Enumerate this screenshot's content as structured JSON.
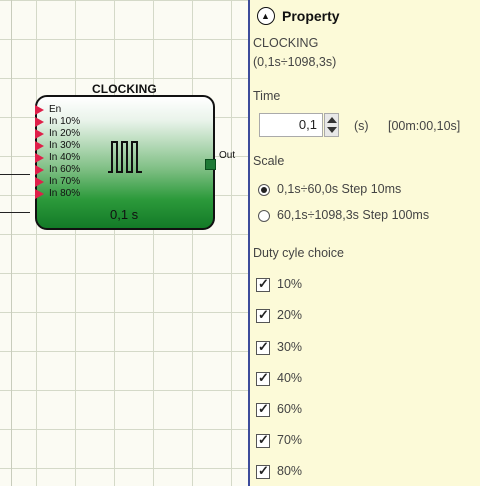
{
  "block": {
    "title": "CLOCKING",
    "inputs": [
      "En",
      "In 10%",
      "In 20%",
      "In 30%",
      "In 40%",
      "In 60%",
      "In 70%",
      "In 80%"
    ],
    "output": "Out",
    "value": "0,1 s"
  },
  "panel": {
    "header": "Property",
    "component_name": "CLOCKING",
    "component_range": "(0,1s÷1098,3s)",
    "time": {
      "label": "Time",
      "value": "0,1",
      "unit": "(s)",
      "formatted": "[00m:00,10s]"
    },
    "scale": {
      "label": "Scale",
      "options": [
        {
          "label": "0,1s÷60,0s Step 10ms",
          "selected": true
        },
        {
          "label": "60,1s÷1098,3s Step 100ms",
          "selected": false
        }
      ]
    },
    "duty": {
      "label": "Duty cyle choice",
      "items": [
        {
          "label": "10%",
          "checked": true
        },
        {
          "label": "20%",
          "checked": true
        },
        {
          "label": "30%",
          "checked": true
        },
        {
          "label": "40%",
          "checked": true
        },
        {
          "label": "60%",
          "checked": true
        },
        {
          "label": "70%",
          "checked": true
        },
        {
          "label": "80%",
          "checked": true
        }
      ]
    }
  },
  "colors": {
    "block_green": "#137a27",
    "input_arrow": "#e0204a",
    "panel_bg": "#fcfad8",
    "separator": "#3c4b9b"
  }
}
